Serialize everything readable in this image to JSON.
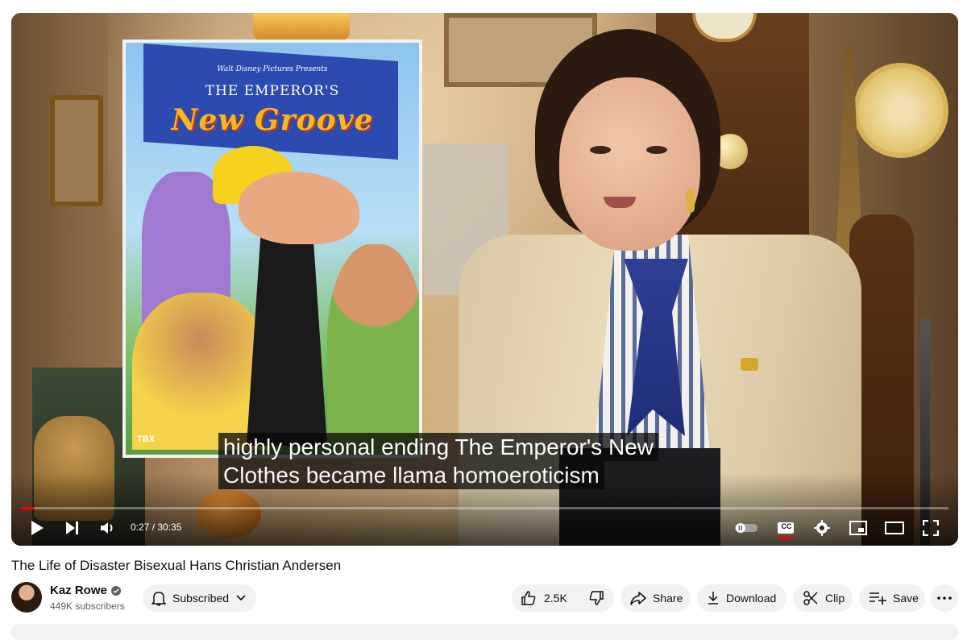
{
  "player": {
    "poster": {
      "brand": "Walt Disney Pictures Presents",
      "title_line1": "THE EMPEROR'S",
      "title_line2": "New Groove",
      "rating": "TBX"
    },
    "captions": [
      "highly personal ending The Emperor's New",
      "Clothes became llama homoeroticism"
    ],
    "progress_fraction": 0.0147,
    "time_current": "0:27",
    "time_separator": " / ",
    "time_total": "30:35",
    "cc_label": "CC",
    "autoplay_on": false
  },
  "video": {
    "title": "The Life of Disaster Bisexual Hans Christian Andersen"
  },
  "channel": {
    "name": "Kaz Rowe",
    "subscribers": "449K subscribers",
    "subscribe_label": "Subscribed"
  },
  "actions": {
    "likes": "2.5K",
    "share": "Share",
    "download": "Download",
    "clip": "Clip",
    "save": "Save"
  },
  "colors": {
    "progress": "#ff0000",
    "pill_bg": "#f2f2f2",
    "text_primary": "#0f0f0f",
    "text_secondary": "#606060"
  },
  "icons": [
    "play-icon",
    "next-icon",
    "volume-icon",
    "autoplay-toggle-icon",
    "captions-icon",
    "settings-icon",
    "miniplayer-icon",
    "theater-icon",
    "fullscreen-icon",
    "bell-icon",
    "chevron-down-icon",
    "thumbs-up-icon",
    "thumbs-down-icon",
    "share-icon",
    "download-icon",
    "scissors-icon",
    "save-playlist-icon",
    "more-icon",
    "verified-icon"
  ]
}
